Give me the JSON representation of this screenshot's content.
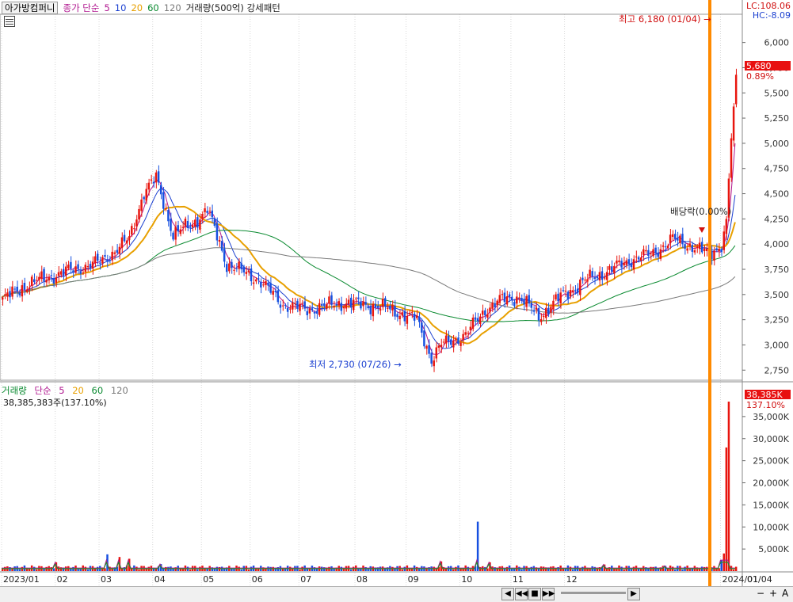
{
  "header": {
    "stock_name": "아가방컴퍼니",
    "legend_prefix": "종가 단순",
    "ma_5": "5",
    "ma_10": "10",
    "ma_20": "20",
    "ma_60": "60",
    "ma_120": "120",
    "indicator": "거래량(500억) 강세패턴"
  },
  "corner": {
    "lc": "LC:108.06",
    "hc": "HC:-8.09"
  },
  "volume_header": {
    "title": "거래량",
    "legend_prefix": "단순",
    "ma_5": "5",
    "ma_20": "20",
    "ma_60": "60",
    "ma_120": "120",
    "value_line": "38,385,383주(137.10%)"
  },
  "colors": {
    "up": "#e8150e",
    "down": "#1650e0",
    "ma5": "#b0168f",
    "ma10": "#1a3fd0",
    "ma20": "#e8a000",
    "ma60": "#0a8a30",
    "ma120": "#7a7a7a",
    "cursor": "#ff8a00"
  },
  "chart_data": [
    {
      "type": "candlestick",
      "title": "아가방컴퍼니",
      "y_ticks": [
        "6,000",
        "5,750",
        "5,500",
        "5,250",
        "5,000",
        "4,750",
        "4,500",
        "4,250",
        "4,000",
        "3,750",
        "3,500",
        "3,250",
        "3,000",
        "2,750"
      ],
      "ylim": [
        2650,
        6280
      ],
      "x_labels": [
        "2023/01",
        "02",
        "03",
        "04",
        "05",
        "06",
        "07",
        "08",
        "09",
        "10",
        "11",
        "12",
        "2024/01",
        "01/04"
      ],
      "annotations": {
        "high": "최고 6,180 (01/04)",
        "low": "최저 2,730 (07/26)",
        "dividend": "배당락(0.00%)",
        "price_badge": "5,680",
        "change_badge": "0.89%"
      },
      "anchors": [
        {
          "x": 0,
          "y": 3450
        },
        {
          "x": 10,
          "y": 3600
        },
        {
          "x": 22,
          "y": 3700
        },
        {
          "x": 40,
          "y": 3820
        },
        {
          "x": 52,
          "y": 4050
        },
        {
          "x": 58,
          "y": 4520
        },
        {
          "x": 63,
          "y": 4650
        },
        {
          "x": 70,
          "y": 4100
        },
        {
          "x": 78,
          "y": 4200
        },
        {
          "x": 84,
          "y": 4350
        },
        {
          "x": 92,
          "y": 3800
        },
        {
          "x": 105,
          "y": 3650
        },
        {
          "x": 115,
          "y": 3400
        },
        {
          "x": 125,
          "y": 3350
        },
        {
          "x": 140,
          "y": 3420
        },
        {
          "x": 155,
          "y": 3380
        },
        {
          "x": 165,
          "y": 3300
        },
        {
          "x": 170,
          "y": 3250
        },
        {
          "x": 176,
          "y": 2860
        },
        {
          "x": 180,
          "y": 3000
        },
        {
          "x": 190,
          "y": 3100
        },
        {
          "x": 198,
          "y": 3350
        },
        {
          "x": 205,
          "y": 3450
        },
        {
          "x": 212,
          "y": 3480
        },
        {
          "x": 220,
          "y": 3280
        },
        {
          "x": 230,
          "y": 3500
        },
        {
          "x": 240,
          "y": 3650
        },
        {
          "x": 250,
          "y": 3750
        },
        {
          "x": 258,
          "y": 3850
        },
        {
          "x": 266,
          "y": 3900
        },
        {
          "x": 275,
          "y": 4050
        },
        {
          "x": 283,
          "y": 3980
        },
        {
          "x": 290,
          "y": 3900
        },
        {
          "x": 295,
          "y": 4000
        },
        {
          "x": 297,
          "y": 4250
        },
        {
          "x": 299,
          "y": 5050
        },
        {
          "x": 301,
          "y": 5680
        }
      ],
      "volume": {
        "y_ticks": [
          "35,000K",
          "30,000K",
          "25,000K",
          "20,000K",
          "15,000K",
          "10,000K",
          "5,000K"
        ],
        "ylim": [
          0,
          40000
        ],
        "badge_value": "38,385K",
        "badge_pct": "137.10%",
        "spikes": [
          {
            "x": 22,
            "v": 2000
          },
          {
            "x": 43,
            "v": 3800
          },
          {
            "x": 48,
            "v": 3200
          },
          {
            "x": 52,
            "v": 2800
          },
          {
            "x": 65,
            "v": 1600
          },
          {
            "x": 180,
            "v": 2200
          },
          {
            "x": 195,
            "v": 11200
          },
          {
            "x": 200,
            "v": 2000
          },
          {
            "x": 247,
            "v": 1500
          },
          {
            "x": 272,
            "v": 1200
          },
          {
            "x": 295,
            "v": 2500
          },
          {
            "x": 296,
            "v": 4000
          },
          {
            "x": 297,
            "v": 28000
          },
          {
            "x": 298,
            "v": 38385
          }
        ]
      }
    }
  ],
  "navigation": {
    "zoom_in": "+",
    "zoom_out": "−",
    "reset": "A"
  }
}
